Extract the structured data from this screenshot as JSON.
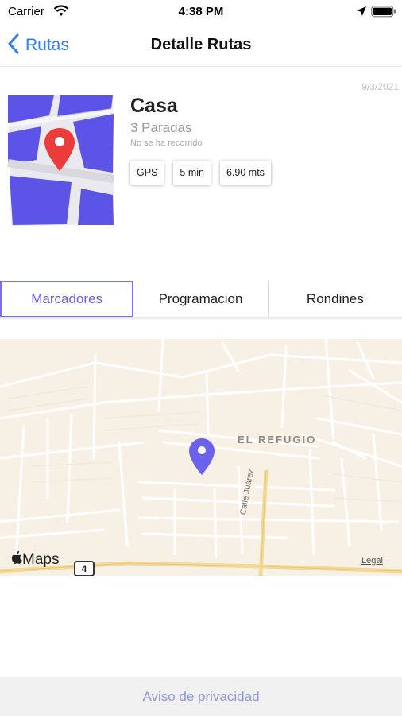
{
  "status_bar": {
    "carrier": "Carrier",
    "time": "4:38 PM",
    "icons": [
      "wifi-icon",
      "location-arrow-icon",
      "battery-icon"
    ]
  },
  "nav": {
    "back_label": "Rutas",
    "title": "Detalle Rutas",
    "accent_color": "#2f80ed"
  },
  "route": {
    "date": "9/3/2021",
    "name": "Casa",
    "stops": "3 Paradas",
    "status": "No se ha recorrido",
    "chips": {
      "mode": "GPS",
      "duration": "5 min",
      "distance": "6.90 mts"
    },
    "thumbnail_icon": "map-pin-illustration"
  },
  "tabs": {
    "items": [
      "Marcadores",
      "Programacion",
      "Rondines"
    ],
    "selected": "Marcadores",
    "active_color": "#6a62e0"
  },
  "map": {
    "area_label": "EL REFUGIO",
    "street_label": "Calle Juárez",
    "road_number": "4",
    "attribution": "Maps",
    "legal": "Legal",
    "marker_color": "#6a62ec"
  },
  "footer": {
    "link": "Aviso de privacidad"
  }
}
